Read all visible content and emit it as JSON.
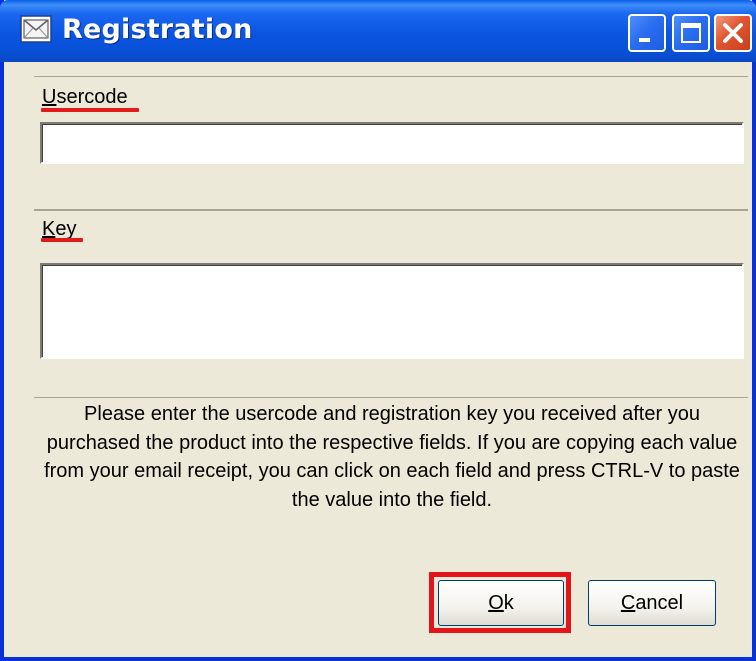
{
  "window": {
    "title": "Registration",
    "icon": "registration-envelope-icon",
    "controls": {
      "minimize": "minimize-icon",
      "maximize": "maximize-icon",
      "close": "close-icon"
    }
  },
  "usercode": {
    "label_mnemonic": "U",
    "label_rest": "sercode",
    "value": ""
  },
  "key": {
    "label_mnemonic": "K",
    "label_rest": "ey",
    "value": ""
  },
  "help_text": "Please enter the usercode and registration key you received after you purchased the product into the respective fields. If you are copying each value from your email receipt, you can click on each field and press CTRL-V to paste the value into the field.",
  "buttons": {
    "ok_mnemonic": "O",
    "ok_rest": "k",
    "cancel_mnemonic": "C",
    "cancel_rest": "ancel"
  },
  "colors": {
    "titlebar": "#0a55e0",
    "window_bg": "#ece9d8",
    "annotation_red": "#e3141c"
  }
}
